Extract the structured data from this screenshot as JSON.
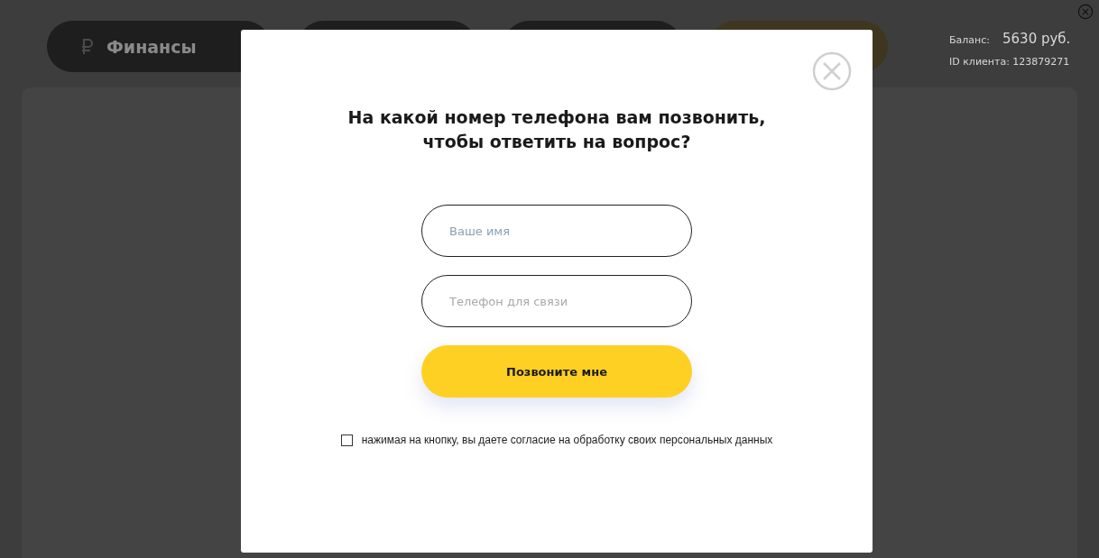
{
  "nav_items": [
    {
      "kind": "finance",
      "label": "Финансы",
      "selected": false
    },
    {
      "kind": "plain",
      "selected": false
    },
    {
      "kind": "plain",
      "selected": false
    },
    {
      "kind": "plain",
      "selected": true
    }
  ],
  "account": {
    "balance_label": "Баланс:",
    "balance_value": "5630 руб.",
    "client_id": "ID клиента: 123879271"
  },
  "dialog": {
    "title": "На какой номер телефона вам позвонить,\nчтобы ответить на вопрос?",
    "fields": [
      {
        "placeholder": "Ваше имя",
        "focused": true
      },
      {
        "placeholder": "Телефон для связи",
        "focused": false
      }
    ],
    "submit": "Позвоните мне",
    "consent": {
      "checked": false,
      "text": "нажимая на кнопку, вы даете согласие на обработку своих персональных данных"
    }
  }
}
